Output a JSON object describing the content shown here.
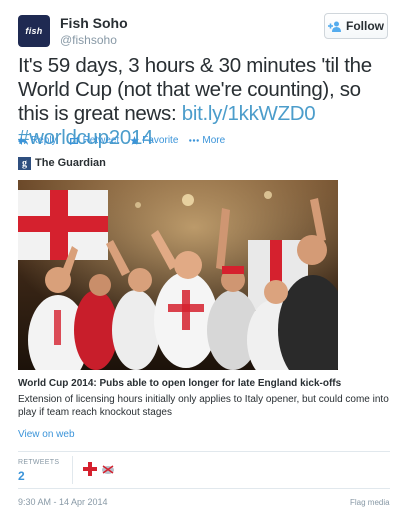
{
  "user": {
    "avatar_text": "fish",
    "name": "Fish Soho",
    "handle": "@fishsoho"
  },
  "follow_label": "Follow",
  "tweet": {
    "text": "It's 59 days, 3 hours & 30 minutes 'til the World Cup (not that we're counting), so this is great news: ",
    "link": "bit.ly/1kkWZD0",
    "hashtag": "#worldcup2014"
  },
  "actions": {
    "reply": "Reply",
    "retweet": "Retweet",
    "favorite": "Favorite",
    "more": "More"
  },
  "card": {
    "source_logo": "g",
    "source_name": "The Guardian",
    "title": "World Cup 2014: Pubs able to open longer for late England kick-offs",
    "description": "Extension of licensing hours initially only applies to Italy opener, but could come into play if team reach knockout stages",
    "view_label": "View on web"
  },
  "stats": {
    "retweets_label": "RETWEETS",
    "retweets_count": "2"
  },
  "footer": {
    "timestamp": "9:30 AM - 14 Apr 2014",
    "flag_media": "Flag media"
  },
  "colors": {
    "link": "#4c9dcb",
    "action": "#3b94d9",
    "muted": "#8899a6",
    "avatar_bg": "#1f2a52"
  },
  "icons": [
    "follow-person-plus-icon",
    "reply-icon",
    "retweet-icon",
    "favorite-star-icon",
    "more-dots-icon"
  ]
}
